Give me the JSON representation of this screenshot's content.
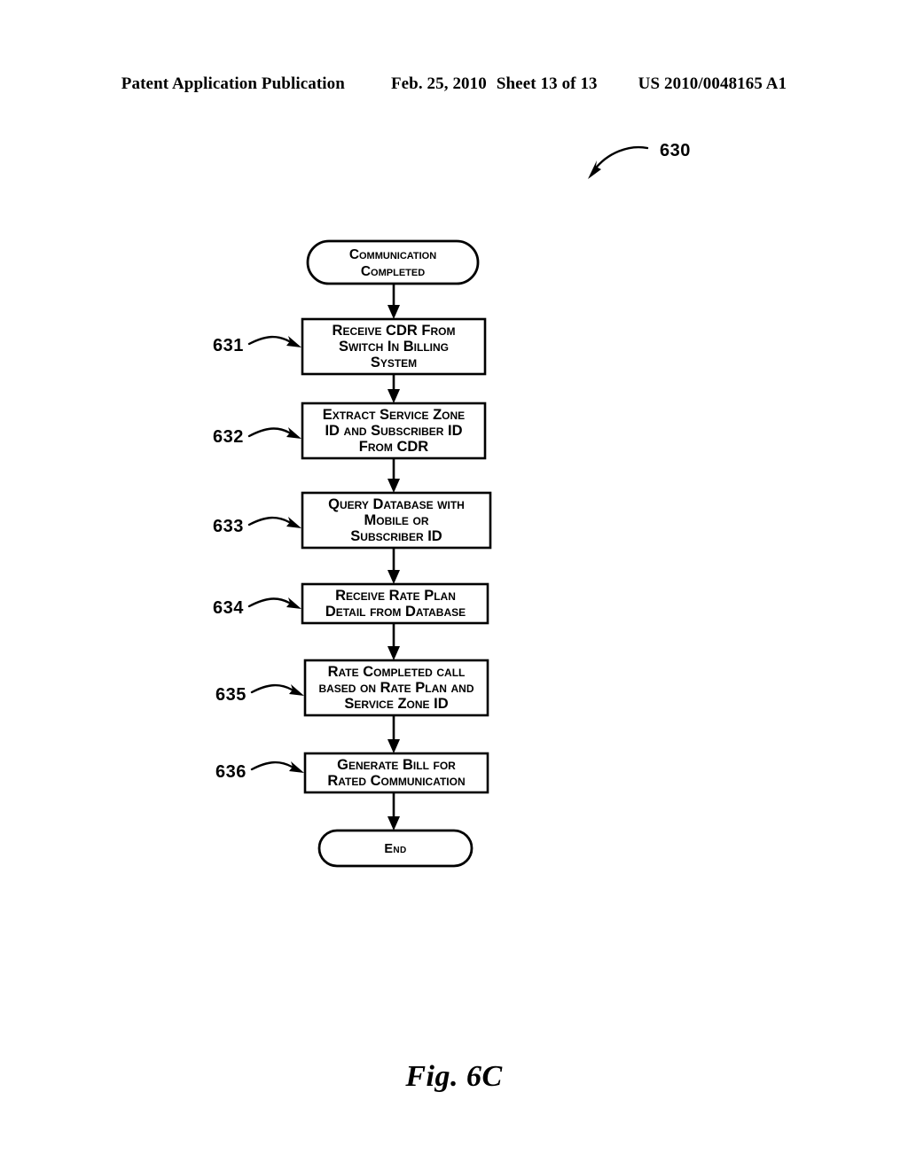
{
  "header": {
    "publication": "Patent Application Publication",
    "date": "Feb. 25, 2010",
    "sheet": "Sheet 13 of 13",
    "patent_number": "US 2010/0048165 A1"
  },
  "figure": {
    "caption": "Fig. 6C",
    "diagram_label": "630"
  },
  "flowchart": {
    "start": {
      "ref": "",
      "lines": [
        "Communication",
        "Completed"
      ]
    },
    "steps": [
      {
        "ref": "631",
        "lines": [
          "Receive CDR From",
          "Switch In Billing",
          "System"
        ]
      },
      {
        "ref": "632",
        "lines": [
          "Extract Service Zone",
          "ID and Subscriber ID",
          "From CDR"
        ]
      },
      {
        "ref": "633",
        "lines": [
          "Query Database with",
          "Mobile or",
          "Subscriber ID"
        ]
      },
      {
        "ref": "634",
        "lines": [
          "Receive Rate Plan",
          "Detail from Database"
        ]
      },
      {
        "ref": "635",
        "lines": [
          "Rate Completed call",
          "based on Rate Plan and",
          "Service Zone ID"
        ]
      },
      {
        "ref": "636",
        "lines": [
          "Generate Bill for",
          "Rated Communication"
        ]
      }
    ],
    "end": {
      "ref": "",
      "lines": [
        "End"
      ]
    }
  },
  "colors": {
    "ink": "#000000",
    "paper": "#ffffff"
  }
}
